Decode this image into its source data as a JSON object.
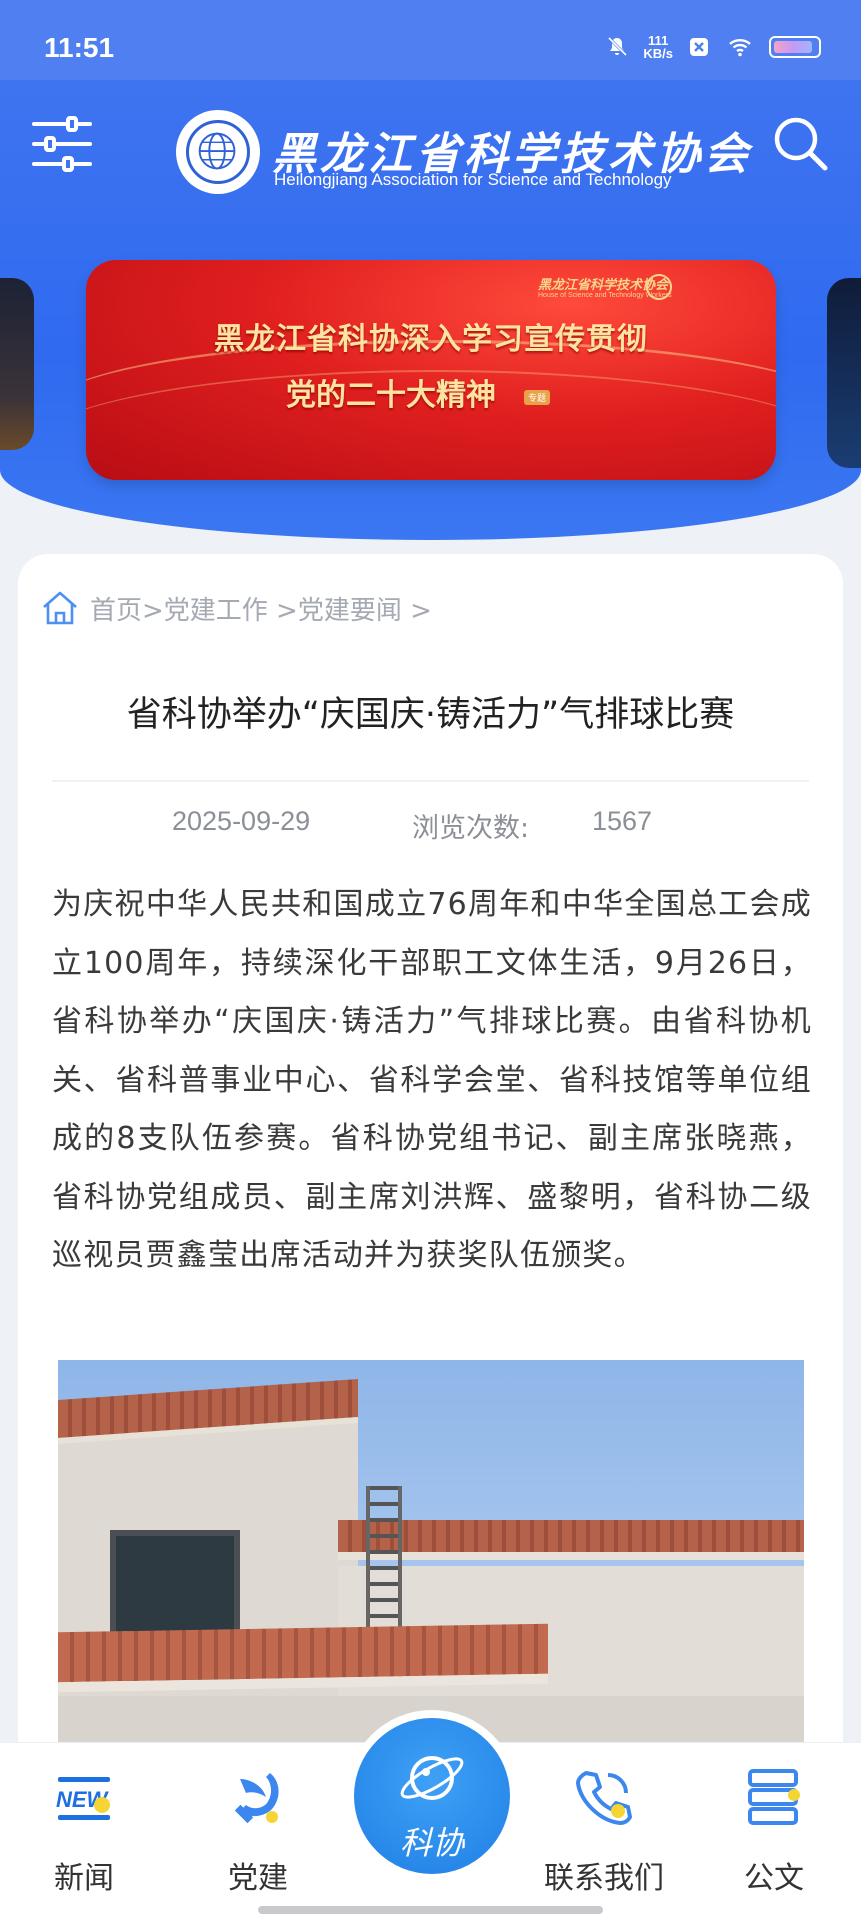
{
  "status_bar": {
    "time": "11:51",
    "net_speed_value": "111",
    "net_speed_unit": "KB/s"
  },
  "header": {
    "org_name_cn": "黑龙江省科学技术协会",
    "org_name_en": "Heilongjiang Association for Science and Technology"
  },
  "banner": {
    "org_cn": "黑龙江省科学技术协会",
    "org_en": "House of Science and Technology Workers",
    "title_line1": "黑龙江省科协深入学习宣传贯彻",
    "title_line2": "党的二十大精神",
    "tag": "专题"
  },
  "article": {
    "breadcrumb": "首页>党建工作 >党建要闻 >",
    "title": "省科协举办“庆国庆·铸活力”气排球比赛",
    "date": "2025-09-29",
    "views_label": "浏览次数:",
    "views": "1567",
    "body": "为庆祝中华人民共和国成立76周年和中华全国总工会成立100周年，持续深化干部职工文体生活，9月26日，省科协举办“庆国庆·铸活力”气排球比赛。由省科协机关、省科普事业中心、省科学会堂、省科技馆等单位组成的8支队伍参赛。省科协党组书记、副主席张晓燕，省科协党组成员、副主席刘洪辉、盛黎明，省科协二级巡视员贾鑫莹出席活动并为获奖队伍颁奖。"
  },
  "bottom_nav": {
    "items": [
      {
        "label": "新闻",
        "icon": "news-icon"
      },
      {
        "label": "党建",
        "icon": "party-emblem-icon"
      },
      {
        "label": "科协",
        "icon": "planet-icon"
      },
      {
        "label": "联系我们",
        "icon": "phone-icon"
      },
      {
        "label": "公文",
        "icon": "documents-icon"
      }
    ]
  },
  "colors": {
    "header_blue": "#3f74f0",
    "banner_red": "#e01f1f",
    "nav_accent": "#1f7fe6"
  }
}
